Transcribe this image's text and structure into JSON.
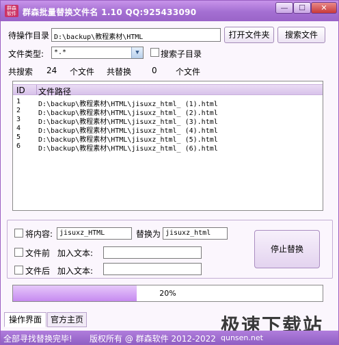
{
  "window": {
    "logo_text": "群森软件",
    "title": "群森批量替换文件名  1.10 QQ:925433090",
    "min_label": "—",
    "max_label": "☐",
    "close_label": "✕"
  },
  "path_row": {
    "label": "待操作目录",
    "value": "D:\\backup\\教程素材\\HTML",
    "open_folder_button": "打开文件夹",
    "search_button": "搜索文件"
  },
  "type_row": {
    "label": "文件类型:",
    "value": "*.*",
    "search_subdirs_label": "搜索子目录"
  },
  "counts": {
    "search_label": "共搜索",
    "search_count": "24",
    "search_unit": "个文件",
    "replace_label": "共替换",
    "replace_count": "0",
    "replace_unit": "个文件"
  },
  "list": {
    "columns": [
      "ID",
      "文件路径"
    ],
    "rows": [
      {
        "id": "1",
        "path": "D:\\backup\\教程素材\\HTML\\jisuxz_html_ (1).html"
      },
      {
        "id": "2",
        "path": "D:\\backup\\教程素材\\HTML\\jisuxz_html_ (2).html"
      },
      {
        "id": "3",
        "path": "D:\\backup\\教程素材\\HTML\\jisuxz_html_ (3).html"
      },
      {
        "id": "4",
        "path": "D:\\backup\\教程素材\\HTML\\jisuxz_html_ (4).html"
      },
      {
        "id": "5",
        "path": "D:\\backup\\教程素材\\HTML\\jisuxz_html_ (5).html"
      },
      {
        "id": "6",
        "path": "D:\\backup\\教程素材\\HTML\\jisuxz_html_ (6).html"
      }
    ]
  },
  "options": {
    "content_label": "将内容:",
    "content_value": "jisuxz_HTML",
    "replace_with_label": "替换为",
    "replace_with_value": "jisuxz_html",
    "prefix_label": "文件前",
    "prefix_text_label": "加入文本:",
    "prefix_value": "",
    "suffix_label": "文件后",
    "suffix_text_label": "加入文本:",
    "suffix_value": ""
  },
  "stop_button": "停止替换",
  "progress": {
    "fraction": 0.4,
    "text": "20%"
  },
  "tabs": [
    {
      "label": "操作界面"
    },
    {
      "label": "官方主页"
    }
  ],
  "status": {
    "message": "全部寻找替换完毕!",
    "copyright": "版权所有 @ 群森软件 2012-2022",
    "site": "qunsen.net"
  },
  "watermark": "极速下载站",
  "colors": {
    "titlebar": "#a46fd2",
    "statusbar": "#9d6acb",
    "progress_fill": "#d7aaf5"
  }
}
